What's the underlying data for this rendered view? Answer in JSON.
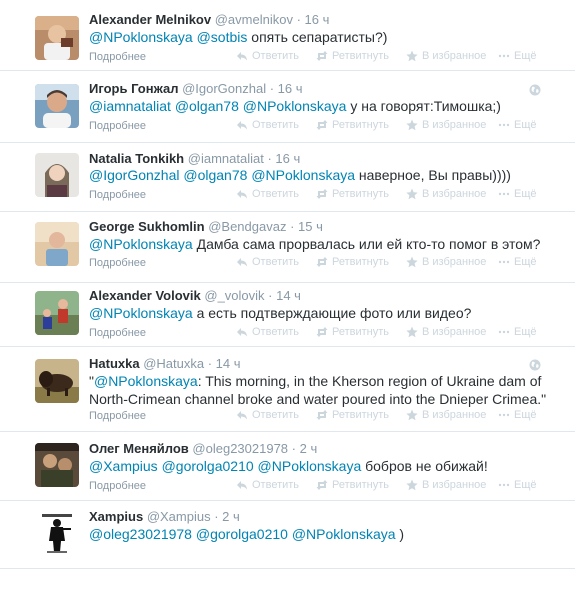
{
  "actions": {
    "reply": "Ответить",
    "retweet": "Ретвитнуть",
    "favorite": "В избранное",
    "more": "Ещё"
  },
  "details_label": "Подробнее",
  "tweets": [
    {
      "fullname": "Alexander Melnikov",
      "username": "@avmelnikov",
      "time": "16 ч",
      "text": "@NPoklonskaya @sotbis опять сепаратисты?)",
      "mentions": [
        "@NPoklonskaya",
        "@sotbis"
      ],
      "avatar_icon": "avatar-photo-icon",
      "has_globe": false
    },
    {
      "fullname": "Игорь Гонжал",
      "username": "@IgorGonzhal",
      "time": "16 ч",
      "text": "@iamnataliat @olgan78 @NPoklonskaya у на говорят:Тимошка;)",
      "mentions": [
        "@iamnataliat",
        "@olgan78",
        "@NPoklonskaya"
      ],
      "avatar_icon": "avatar-photo-icon",
      "has_globe": true
    },
    {
      "fullname": "Natalia Tonkikh",
      "username": "@iamnataliat",
      "time": "16 ч",
      "text": "@IgorGonzhal @olgan78 @NPoklonskaya наверное, Вы правы))))",
      "mentions": [
        "@IgorGonzhal",
        "@olgan78",
        "@NPoklonskaya"
      ],
      "avatar_icon": "avatar-photo-icon",
      "has_globe": false
    },
    {
      "fullname": "George Sukhomlin",
      "username": "@Bendgavaz",
      "time": "15 ч",
      "text": "@NPoklonskaya Дамба сама прорвалась или ей кто-то помог в этом?",
      "mentions": [
        "@NPoklonskaya"
      ],
      "avatar_icon": "avatar-photo-icon",
      "has_globe": false
    },
    {
      "fullname": "Alexander Volovik",
      "username": "@_volovik",
      "time": "14 ч",
      "text": "@NPoklonskaya а есть подтверждающие фото или видео?",
      "mentions": [
        "@NPoklonskaya"
      ],
      "avatar_icon": "avatar-photo-icon",
      "has_globe": false
    },
    {
      "fullname": "Hatuxka",
      "username": "@Hatuxka",
      "time": "14 ч",
      "text": "\"@NPoklonskaya: This morning, in the Kherson region of Ukraine dam of North-Crimean channel broke and water poured into the Dnieper Crimea.\"",
      "mentions": [
        "@NPoklonskaya"
      ],
      "avatar_icon": "bison-avatar-icon",
      "has_globe": true
    },
    {
      "fullname": "Олег Меняйлов",
      "username": "@oleg23021978",
      "time": "2 ч",
      "text": "@Xampius @gorolga0210 @NPoklonskaya бобров не обижай!",
      "mentions": [
        "@Xampius",
        "@gorolga0210",
        "@NPoklonskaya"
      ],
      "avatar_icon": "avatar-photo-icon",
      "has_globe": false
    },
    {
      "fullname": "Xampius",
      "username": "@Xampius",
      "time": "2 ч",
      "text": "@oleg23021978 @gorolga0210 @NPoklonskaya )",
      "mentions": [
        "@oleg23021978",
        "@gorolga0210",
        "@NPoklonskaya"
      ],
      "avatar_icon": "soldier-avatar-icon",
      "has_globe": false
    }
  ]
}
